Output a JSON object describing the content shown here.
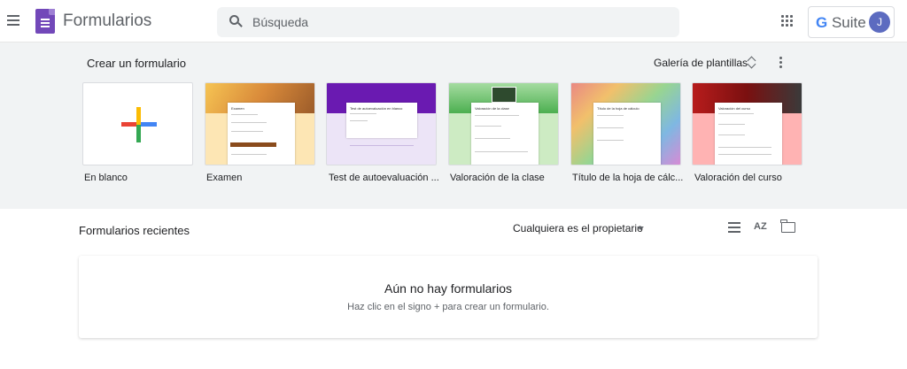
{
  "header": {
    "app_title": "Formularios",
    "search_placeholder": "Búsqueda",
    "account_brand": "Suite",
    "account_brand_g": "G",
    "avatar_initial": "J"
  },
  "templates": {
    "section_title": "Crear un formulario",
    "gallery_label": "Galería de plantillas",
    "items": [
      {
        "label": "En blanco"
      },
      {
        "label": "Examen",
        "preview_title": "Examen",
        "color": "#f6c453"
      },
      {
        "label": "Test de autoevaluación ...",
        "preview_title": "Test de autoevaluación en blanco",
        "color": "#6a1ab1"
      },
      {
        "label": "Valoración de la clase",
        "preview_title": "Valoración de la clase",
        "color": "#7cc576"
      },
      {
        "label": "Título de la hoja de cálc...",
        "preview_title": "Título de la hoja de cálculo",
        "color": "#e96a6a"
      },
      {
        "label": "Valoración del curso",
        "preview_title": "Valoración del curso",
        "color": "#b71c1c"
      }
    ]
  },
  "recent": {
    "title": "Formularios recientes",
    "owner_filter": "Cualquiera es el propietario",
    "sort_label": "AZ",
    "empty_title": "Aún no hay formularios",
    "empty_subtitle": "Haz clic en el signo + para crear un formulario."
  },
  "colors": {
    "brand_purple": "#7248b9",
    "gray_bg": "#f1f3f4",
    "avatar": "#5c6bc0"
  }
}
